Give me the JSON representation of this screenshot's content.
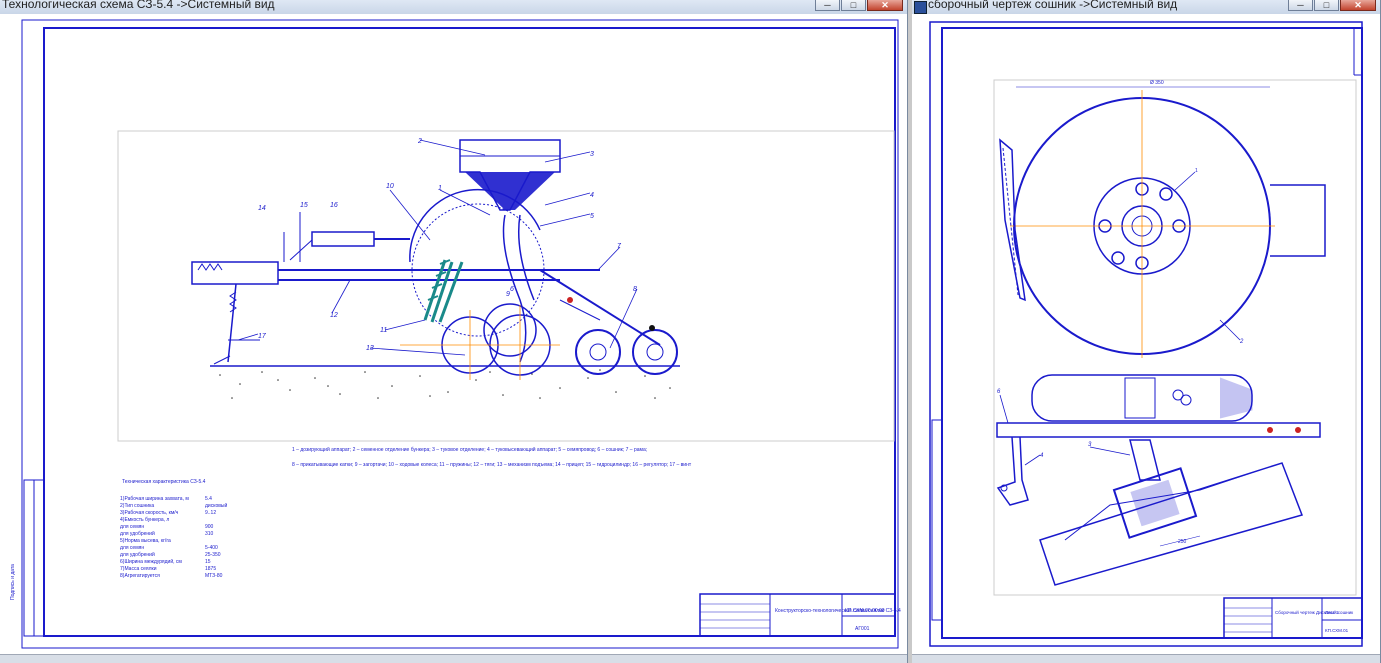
{
  "left_window": {
    "title": "Технологическая схема СЗ-5.4 ->Системный вид",
    "controls": {
      "minimize": "─",
      "maximize": "□",
      "close": "✕"
    },
    "drawing": {
      "callouts": [
        "1",
        "2",
        "3",
        "4",
        "5",
        "6",
        "7",
        "8",
        "9",
        "10",
        "11",
        "12",
        "13",
        "14",
        "15",
        "16",
        "17"
      ],
      "legend_line1": "1 – дозирующий аппарат; 2 – семенное отделение бункера; 3 – туковое отделение; 4 – туковысевающий аппарат; 5 – семяпровод; 6 – сошник; 7 – рама;",
      "legend_line2": "8 – прикатывающие катки; 9 – загортачи; 10 – ходовые колеса; 11 – пружины; 12 – тяги; 13 – механизм подъема; 14 – прицеп; 15 – гидроцилиндр; 16 – регулятор; 17 – винт",
      "spec_title": "Техническая характеристика СЗ-5.4",
      "spec_rows": [
        [
          "1)Рабочая ширина захвата, м",
          "5.4"
        ],
        [
          "2)Тип сошника",
          "дисковый"
        ],
        [
          "3)Рабочая скорость, км/ч",
          "9..12"
        ],
        [
          "4)Емкость бункера, л",
          ""
        ],
        [
          "для семян",
          "900"
        ],
        [
          "для удобрений",
          "310"
        ],
        [
          "5)Норма высева, кг/га",
          ""
        ],
        [
          "для семян",
          "5-400"
        ],
        [
          "для удобрений",
          "25-350"
        ],
        [
          "6)Ширина междурядий, см",
          "15"
        ],
        [
          "7)Масса сеялки",
          "1875"
        ],
        [
          "8)Агрегатируется",
          "МТЗ-80"
        ]
      ],
      "stamp_title": "Конструкторско-технологическая схема сеялки СЗ-5.4",
      "stamp_code": "КП.СХМ.00.00.00",
      "stamp_group": "АГ001",
      "side_label": "Подпись и дата"
    }
  },
  "right_window": {
    "title": "сборочный чертеж  сошник ->Системный вид",
    "controls": {
      "minimize": "─",
      "maximize": "□",
      "close": "✕"
    },
    "drawing": {
      "dim_top": "Ø 350",
      "callout_hub": "1",
      "callout_disc": "2",
      "callout_frame": "6",
      "callout_bracket": "4",
      "callout_holder": "3",
      "dim_bottom": "250",
      "stamp_title": "Сборочный чертеж Дисковый сошник",
      "stamp_code": "КП.СХМ.01",
      "stamp_sheet": "Лист 1"
    }
  },
  "colors": {
    "drawing_blue": "#1a1acc",
    "axis_orange": "#ff8c00",
    "hatch_teal": "#1a8a8a"
  }
}
